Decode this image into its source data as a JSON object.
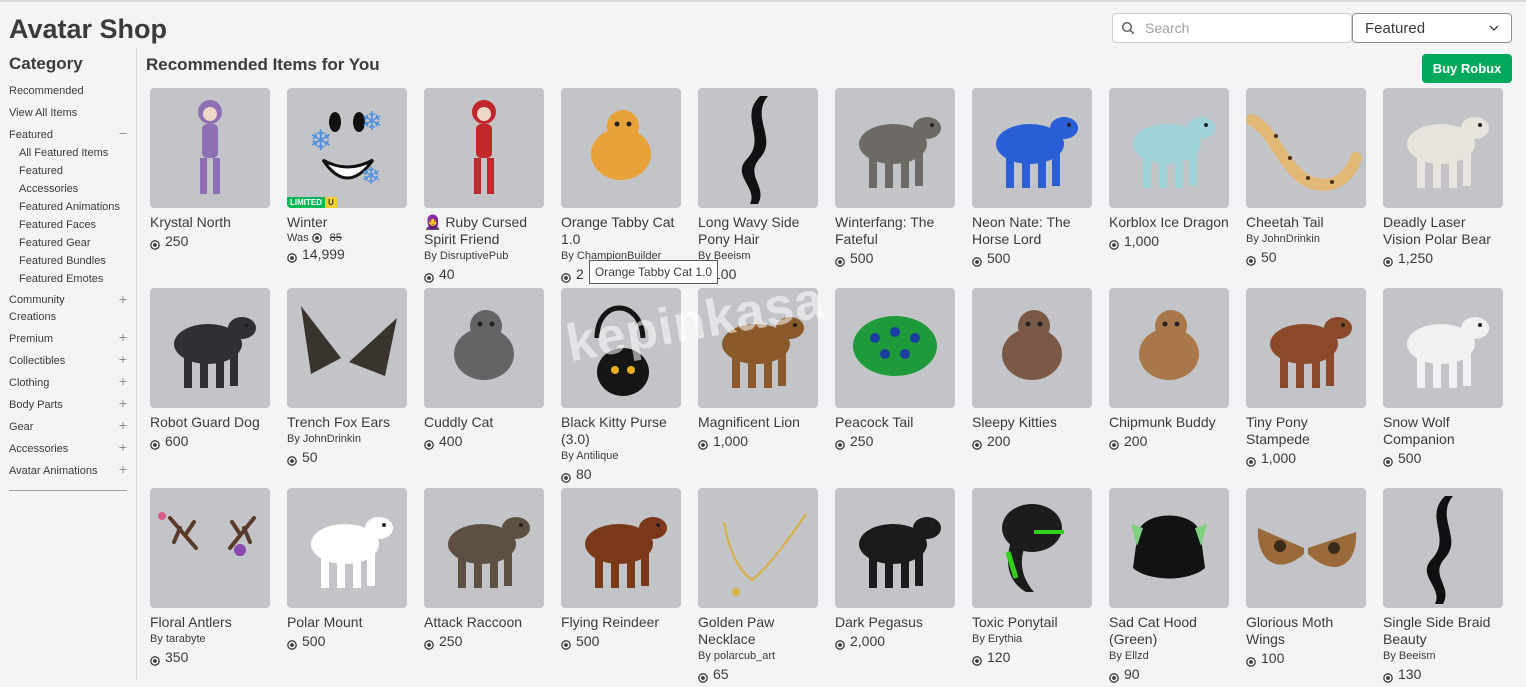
{
  "header": {
    "title": "Avatar Shop",
    "search_placeholder": "Search",
    "sort_selected": "Featured",
    "buy_robux_label": "Buy Robux"
  },
  "sidebar": {
    "heading": "Category",
    "items": [
      {
        "label": "Recommended",
        "toggle": ""
      },
      {
        "label": "View All Items",
        "toggle": ""
      },
      {
        "label": "Featured",
        "toggle": "−"
      },
      {
        "label": "Community Creations",
        "toggle": "+"
      },
      {
        "label": "Premium",
        "toggle": "+"
      },
      {
        "label": "Collectibles",
        "toggle": "+"
      },
      {
        "label": "Clothing",
        "toggle": "+"
      },
      {
        "label": "Body Parts",
        "toggle": "+"
      },
      {
        "label": "Gear",
        "toggle": "+"
      },
      {
        "label": "Accessories",
        "toggle": "+"
      },
      {
        "label": "Avatar Animations",
        "toggle": "+"
      }
    ],
    "featured_subitems": [
      "All Featured Items",
      "Featured",
      "Accessories",
      "Featured Animations",
      "Featured Faces",
      "Featured Gear",
      "Featured Bundles",
      "Featured Emotes"
    ]
  },
  "main": {
    "section_title": "Recommended Items for You",
    "tooltip": "Orange Tabby Cat 1.0",
    "watermark": "kepinkasa",
    "limited_badge": {
      "limited": "LIMITED",
      "u": "U"
    },
    "was_label": "Was",
    "items": [
      {
        "name": "Krystal North",
        "creator": "",
        "price": "250",
        "was": "",
        "icon": "anime-character-icon",
        "color": "#8e6fb3"
      },
      {
        "name": "Winter",
        "creator": "",
        "price": "14,999",
        "was": "85",
        "icon": "snowflake-face-icon",
        "color": "#ffffff",
        "limited": true
      },
      {
        "name": "🧕 Ruby Cursed Spirit Friend",
        "creator": "DisruptivePub",
        "price": "40",
        "was": "",
        "icon": "red-hood-character-icon",
        "color": "#c0282b"
      },
      {
        "name": "Orange Tabby Cat 1.0",
        "creator": "ChampionBuilder",
        "price": "2",
        "was": "",
        "icon": "orange-cat-icon",
        "color": "#e8a23a"
      },
      {
        "name": "Long Wavy Side Pony Hair",
        "creator": "Beeism",
        "price": "100",
        "was": "",
        "icon": "black-hair-icon",
        "color": "#111111"
      },
      {
        "name": "Winterfang: The Fateful",
        "creator": "",
        "price": "500",
        "was": "",
        "icon": "wolf-icon",
        "color": "#6d6a66"
      },
      {
        "name": "Neon Nate: The Horse Lord",
        "creator": "",
        "price": "500",
        "was": "",
        "icon": "blue-horse-icon",
        "color": "#2a5ed6"
      },
      {
        "name": "Korblox Ice Dragon",
        "creator": "",
        "price": "1,000",
        "was": "",
        "icon": "ice-dragon-icon",
        "color": "#9fd3d8"
      },
      {
        "name": "Cheetah Tail",
        "creator": "JohnDrinkin",
        "price": "50",
        "was": "",
        "icon": "cheetah-tail-icon",
        "color": "#e2b877"
      },
      {
        "name": "Deadly Laser Vision Polar Bear",
        "creator": "",
        "price": "1,250",
        "was": "",
        "icon": "polar-bear-icon",
        "color": "#e6e4dd"
      },
      {
        "name": "Robot Guard Dog",
        "creator": "",
        "price": "600",
        "was": "",
        "icon": "robot-dog-icon",
        "color": "#2f3033"
      },
      {
        "name": "Trench Fox Ears",
        "creator": "JohnDrinkin",
        "price": "50",
        "was": "",
        "icon": "fox-ears-icon",
        "color": "#3a342e"
      },
      {
        "name": "Cuddly Cat",
        "creator": "",
        "price": "400",
        "was": "",
        "icon": "gray-cat-icon",
        "color": "#626466"
      },
      {
        "name": "Black Kitty Purse (3.0)",
        "creator": "Antilique",
        "price": "80",
        "was": "",
        "icon": "cat-purse-icon",
        "color": "#151515"
      },
      {
        "name": "Magnificent Lion",
        "creator": "",
        "price": "1,000",
        "was": "",
        "icon": "lion-icon",
        "color": "#8a5a2b"
      },
      {
        "name": "Peacock Tail",
        "creator": "",
        "price": "250",
        "was": "",
        "icon": "peacock-tail-icon",
        "color": "#1f9a3a"
      },
      {
        "name": "Sleepy Kitties",
        "creator": "",
        "price": "200",
        "was": "",
        "icon": "sleepy-kitties-icon",
        "color": "#7a5a46"
      },
      {
        "name": "Chipmunk Buddy",
        "creator": "",
        "price": "200",
        "was": "",
        "icon": "chipmunk-icon",
        "color": "#a8784a"
      },
      {
        "name": "Tiny Pony Stampede",
        "creator": "",
        "price": "1,000",
        "was": "",
        "icon": "pony-icon",
        "color": "#8a4a2a"
      },
      {
        "name": "Snow Wolf Companion",
        "creator": "",
        "price": "500",
        "was": "",
        "icon": "snow-wolf-icon",
        "color": "#f1f1f1"
      },
      {
        "name": "Floral Antlers",
        "creator": "tarabyte",
        "price": "350",
        "was": "",
        "icon": "antlers-icon",
        "color": "#5a3a2a"
      },
      {
        "name": "Polar Mount",
        "creator": "",
        "price": "500",
        "was": "",
        "icon": "polar-mount-icon",
        "color": "#ffffff"
      },
      {
        "name": "Attack Raccoon",
        "creator": "",
        "price": "250",
        "was": "",
        "icon": "raccoon-icon",
        "color": "#5d5043"
      },
      {
        "name": "Flying Reindeer",
        "creator": "",
        "price": "500",
        "was": "",
        "icon": "reindeer-icon",
        "color": "#7a3a1a"
      },
      {
        "name": "Golden Paw Necklace",
        "creator": "polarcub_art",
        "price": "65",
        "was": "",
        "icon": "necklace-icon",
        "color": "#d8b14a"
      },
      {
        "name": "Dark Pegasus",
        "creator": "",
        "price": "2,000",
        "was": "",
        "icon": "dark-pegasus-icon",
        "color": "#1b1b1b"
      },
      {
        "name": "Toxic Ponytail",
        "creator": "Erythia",
        "price": "120",
        "was": "",
        "icon": "toxic-ponytail-icon",
        "color": "#1c1c1c"
      },
      {
        "name": "Sad Cat Hood (Green)",
        "creator": "Ellzd",
        "price": "90",
        "was": "",
        "icon": "cat-hood-icon",
        "color": "#121212"
      },
      {
        "name": "Glorious Moth Wings",
        "creator": "",
        "price": "100",
        "was": "",
        "icon": "moth-wings-icon",
        "color": "#9a6a3a"
      },
      {
        "name": "Single Side Braid Beauty",
        "creator": "Beeism",
        "price": "130",
        "was": "",
        "icon": "braid-hair-icon",
        "color": "#101010"
      }
    ]
  }
}
